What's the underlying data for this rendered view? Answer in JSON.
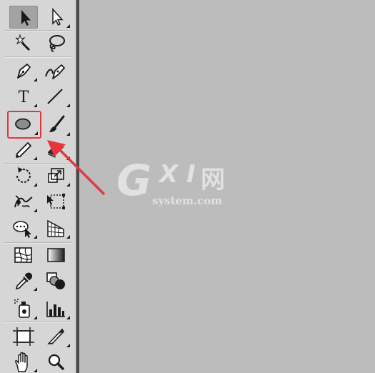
{
  "colors": {
    "toolbar_bg": "#d6d6d6",
    "canvas_bg": "#bcbcbc",
    "highlight_red": "#e8353c",
    "icon_stroke": "#222222"
  },
  "toolbar": {
    "tools": [
      {
        "id": "selection",
        "icon": "selection-arrow-icon",
        "active": true
      },
      {
        "id": "direct-selection",
        "icon": "direct-selection-arrow-icon",
        "flyout": true
      },
      {
        "id": "magic-wand",
        "icon": "magic-wand-icon"
      },
      {
        "id": "lasso",
        "icon": "lasso-icon"
      },
      {
        "id": "pen",
        "icon": "pen-nib-icon",
        "flyout": true
      },
      {
        "id": "curvature",
        "icon": "curvature-pen-icon"
      },
      {
        "id": "type",
        "icon": "type-icon",
        "glyph": "T",
        "flyout": true
      },
      {
        "id": "line-segment",
        "icon": "line-segment-icon",
        "flyout": true
      },
      {
        "id": "ellipse",
        "icon": "ellipse-icon",
        "flyout": true,
        "highlighted": true
      },
      {
        "id": "paintbrush",
        "icon": "paintbrush-icon",
        "flyout": true
      },
      {
        "id": "pencil",
        "icon": "pencil-icon",
        "flyout": true
      },
      {
        "id": "eraser",
        "icon": "eraser-icon",
        "flyout": true
      },
      {
        "id": "rotate",
        "icon": "rotate-icon",
        "flyout": true
      },
      {
        "id": "scale",
        "icon": "scale-icon",
        "flyout": true
      },
      {
        "id": "warp",
        "icon": "warp-icon",
        "flyout": true
      },
      {
        "id": "free-transform",
        "icon": "free-transform-icon"
      },
      {
        "id": "shape-builder",
        "icon": "shape-builder-icon",
        "flyout": true
      },
      {
        "id": "perspective-grid",
        "icon": "perspective-grid-icon",
        "flyout": true
      },
      {
        "id": "mesh",
        "icon": "mesh-icon"
      },
      {
        "id": "gradient",
        "icon": "gradient-icon"
      },
      {
        "id": "eyedropper",
        "icon": "eyedropper-icon",
        "flyout": true
      },
      {
        "id": "blend",
        "icon": "blend-icon"
      },
      {
        "id": "symbol-sprayer",
        "icon": "symbol-sprayer-icon",
        "flyout": true
      },
      {
        "id": "column-graph",
        "icon": "column-graph-icon",
        "flyout": true
      },
      {
        "id": "artboard",
        "icon": "artboard-icon"
      },
      {
        "id": "slice",
        "icon": "slice-icon",
        "flyout": true
      },
      {
        "id": "hand",
        "icon": "hand-icon",
        "flyout": true
      },
      {
        "id": "zoom",
        "icon": "zoom-icon"
      }
    ]
  },
  "watermark": {
    "brand_g": "G",
    "brand_xi": "X I",
    "brand_wang": "网",
    "domain": "system.com"
  }
}
